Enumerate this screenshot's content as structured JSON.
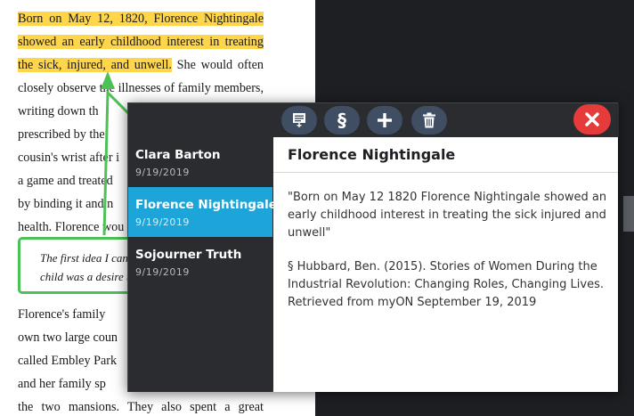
{
  "book": {
    "lines": [
      {
        "segments": [
          {
            "text": "Born on May 12, 1820, Florence Nightingale",
            "hl": true
          }
        ],
        "just": true
      },
      {
        "segments": [
          {
            "text": "showed an early childhood interest in treating",
            "hl": true
          }
        ],
        "just": true
      },
      {
        "segments": [
          {
            "text": "the sick, injured, and unwell.",
            "hl": true
          },
          {
            "text": " She would often",
            "hl": false
          }
        ],
        "just": true
      },
      {
        "segments": [
          {
            "text": "closely observe the illnesses of family members,",
            "hl": false
          }
        ],
        "just": true
      },
      {
        "segments": [
          {
            "text": "writing down th",
            "hl": false
          }
        ],
        "just": false
      },
      {
        "segments": [
          {
            "text": "prescribed by the",
            "hl": false
          }
        ],
        "just": false
      },
      {
        "segments": [
          {
            "text": "cousin's wrist after i",
            "hl": false
          }
        ],
        "just": false
      },
      {
        "segments": [
          {
            "text": "a game and treated",
            "hl": false
          }
        ],
        "just": false
      },
      {
        "segments": [
          {
            "text": "by binding it and n",
            "hl": false
          }
        ],
        "just": false
      },
      {
        "segments": [
          {
            "text": "health. Florence wou",
            "hl": false
          }
        ],
        "just": false
      },
      {
        "segments": [
          {
            "text": "Florence's family",
            "hl": false
          }
        ],
        "just": false
      },
      {
        "segments": [
          {
            "text": "own two large coun",
            "hl": false
          }
        ],
        "just": false
      },
      {
        "segments": [
          {
            "text": "called Embley Park",
            "hl": false
          }
        ],
        "just": false
      },
      {
        "segments": [
          {
            "text": "and her family sp",
            "hl": false
          }
        ],
        "just": false
      },
      {
        "segments": [
          {
            "text": "the two mansions. They also spent a great",
            "hl": false
          }
        ],
        "just": true
      }
    ],
    "note_lines": [
      "The first idea I can",
      "child was a desire t"
    ]
  },
  "toolbar": {
    "note_icon": "note-icon",
    "citation_label": "§",
    "add_icon": "plus-icon",
    "delete_icon": "trash-icon",
    "close_icon": "close-icon"
  },
  "notes": [
    {
      "title": "Clara Barton",
      "date": "9/19/2019",
      "selected": false
    },
    {
      "title": "Florence Nightingale",
      "date": "9/19/2019",
      "selected": true
    },
    {
      "title": "Sojourner Truth",
      "date": "9/19/2019",
      "selected": false
    }
  ],
  "detail": {
    "title": "Florence Nightingale",
    "quote": "\"Born on May 12 1820 Florence Nightingale showed an early childhood interest in treating the sick injured and unwell\"",
    "citation": "§ Hubbard, Ben. (2015). Stories of Women During the Industrial Revolution: Changing Roles, Changing Lives. Retrieved from myON September 19, 2019"
  },
  "colors": {
    "highlight": "#ffd54a",
    "selected_note": "#1da4d8",
    "close_button": "#e53b3b",
    "toolbar_button": "#3f4e63",
    "note_border": "#4cc155"
  }
}
